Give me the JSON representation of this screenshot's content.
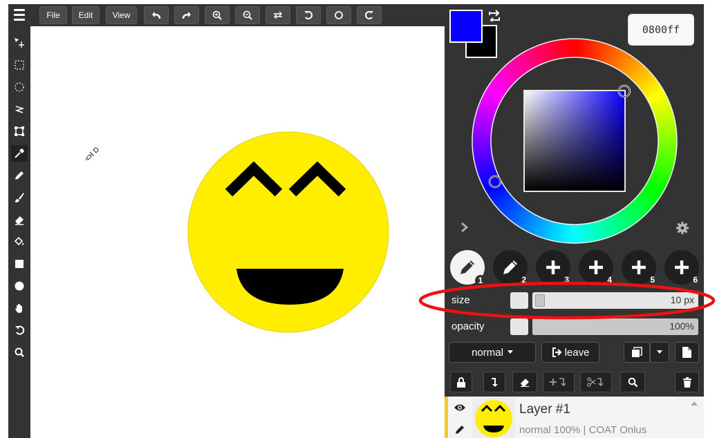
{
  "menubar": {
    "file_label": "File",
    "edit_label": "Edit",
    "view_label": "View"
  },
  "color": {
    "hex_value": "0800ff",
    "primary": "#0800ff",
    "secondary": "#000000"
  },
  "brushes": [
    {
      "number": "1",
      "icon": "pencil-icon"
    },
    {
      "number": "2",
      "icon": "pencil-icon"
    },
    {
      "number": "3",
      "icon": "plus-icon"
    },
    {
      "number": "4",
      "icon": "plus-icon"
    },
    {
      "number": "5",
      "icon": "plus-icon"
    },
    {
      "number": "6",
      "icon": "plus-icon"
    }
  ],
  "size": {
    "label": "size",
    "value": "10 px",
    "fraction": 0.03
  },
  "opacity": {
    "label": "opacity",
    "value": "100%",
    "fraction": 1.0
  },
  "layer_controls": {
    "blend_mode": "normal",
    "leave_label": "leave"
  },
  "layer": {
    "name": "Layer #1",
    "details": "normal 100% | COAT Onlus"
  }
}
